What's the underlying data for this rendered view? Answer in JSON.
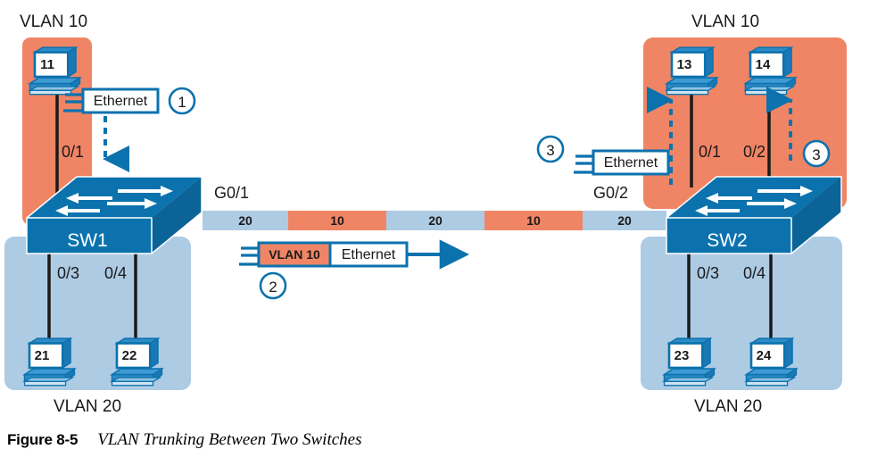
{
  "figure": {
    "number_label": "Figure 8-5",
    "title": "VLAN Trunking Between Two Switches"
  },
  "colors": {
    "vlan10_zone": "#F08565",
    "vlan20_zone": "#AECBE4",
    "switch_top": "#0C72AE",
    "switch_front": "#0C72AE",
    "switch_side": "#0C72AE",
    "outline_blue": "#0C72AE",
    "cable_black": "#1A1A1A",
    "text_dark": "#1A1A1A",
    "trunk_vlan20": "#AECBE4",
    "trunk_vlan10": "#F08565",
    "white": "#FFFFFF"
  },
  "left": {
    "vlan10_label": "VLAN 10",
    "vlan20_label": "VLAN 20",
    "switch_name": "SW1",
    "trunk_port_label": "G0/1",
    "pcs": [
      {
        "name": "11",
        "port": "0/1",
        "vlan": "10"
      },
      {
        "name": "21",
        "port": "0/3",
        "vlan": "20"
      },
      {
        "name": "22",
        "port": "0/4",
        "vlan": "20"
      }
    ],
    "ports": {
      "p1": "0/1",
      "p3": "0/3",
      "p4": "0/4"
    }
  },
  "right": {
    "vlan10_label": "VLAN 10",
    "vlan20_label": "VLAN 20",
    "switch_name": "SW2",
    "trunk_port_label": "G0/2",
    "pcs": [
      {
        "name": "13",
        "port": "0/1",
        "vlan": "10"
      },
      {
        "name": "14",
        "port": "0/2",
        "vlan": "10"
      },
      {
        "name": "23",
        "port": "0/3",
        "vlan": "20"
      },
      {
        "name": "24",
        "port": "0/4",
        "vlan": "20"
      }
    ],
    "ports": {
      "p1": "0/1",
      "p2": "0/2",
      "p3": "0/3",
      "p4": "0/4"
    }
  },
  "frames": {
    "step1": {
      "step": "1",
      "parts": [
        {
          "text": "Ethernet",
          "kind": "plain"
        }
      ]
    },
    "step2": {
      "step": "2",
      "parts": [
        {
          "text": "VLAN 10",
          "kind": "tag"
        },
        {
          "text": "Ethernet",
          "kind": "plain"
        }
      ]
    },
    "step3": {
      "step": "3",
      "step_right": "3",
      "parts": [
        {
          "text": "Ethernet",
          "kind": "plain"
        }
      ]
    }
  },
  "trunk": {
    "segments": [
      {
        "label": "20",
        "vlan": "20"
      },
      {
        "label": "10",
        "vlan": "10"
      },
      {
        "label": "20",
        "vlan": "20"
      },
      {
        "label": "10",
        "vlan": "10"
      },
      {
        "label": "20",
        "vlan": "20"
      }
    ]
  }
}
